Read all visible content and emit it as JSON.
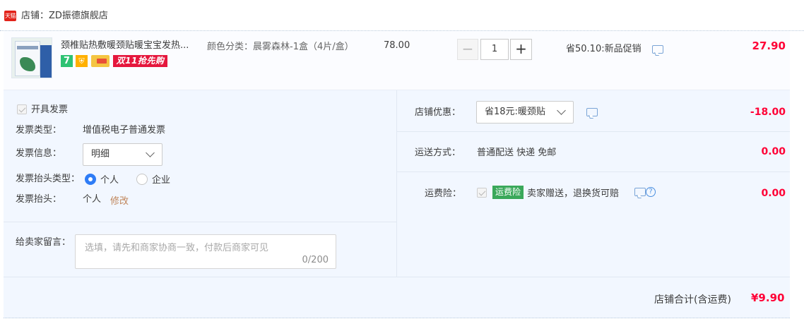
{
  "shop": {
    "badge": "天猫",
    "label": "店铺：ZD振德旗舰店"
  },
  "item": {
    "title": "颈椎贴热敷暖颈贴暖宝宝发热...",
    "icons": [
      "seven-day-return-icon",
      "shield-icon",
      "card-icon"
    ],
    "promo_tag": "双11抢先购",
    "sku": "颜色分类：晨雾森林-1盒（4片/盒）",
    "unit_price": "78.00",
    "qty_minus": "−",
    "quantity": "1",
    "qty_plus": "+",
    "promotion": "省50.10:新品促销",
    "subtotal": "27.90"
  },
  "invoice": {
    "toggle_label": "开具发票",
    "type_label": "发票类型：",
    "type_value": "增值税电子普通发票",
    "info_label": "发票信息：",
    "info_value": "明细",
    "title_type_label": "发票抬头类型：",
    "options": [
      "个人",
      "企业"
    ],
    "selected_option": "个人",
    "title_label": "发票抬头：",
    "title_value": "个人",
    "edit_link": "修改"
  },
  "message": {
    "label": "给卖家留言：",
    "placeholder": "选填，请先和商家协商一致，付款后商家可见",
    "counter": "0/200"
  },
  "discount": {
    "label": "店铺优惠：",
    "selected": "省18元:暖颈贴",
    "amount": "-18.00"
  },
  "shipping": {
    "label": "运送方式：",
    "value": "普通配送 快递 免邮",
    "amount": "0.00"
  },
  "insurance": {
    "label": "运费险：",
    "badge": "运费险",
    "text": "卖家赠送，退换货可赔",
    "help": "?",
    "amount": "0.00"
  },
  "total": {
    "label": "店铺合计(含运费)",
    "value": "¥9.90"
  },
  "colors": {
    "price_red": "#ff0036",
    "panel_bg": "#f2f7ff",
    "radio_blue": "#2e7cf6",
    "insurance_green": "#3aa85a",
    "promo_red": "#e5173d"
  }
}
